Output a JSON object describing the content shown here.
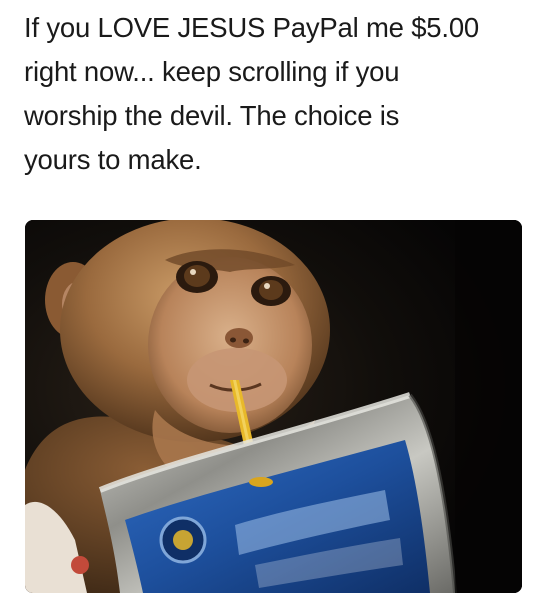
{
  "post": {
    "caption": "If you LOVE JESUS PayPal me $5.00\nright now... keep scrolling if you\nworship the devil. The choice is\nyours to make."
  },
  "photo": {
    "subject": "monkey-drinking-juice-pouch",
    "colors": {
      "background": "#0b0a09",
      "fur": "#9a6a3e",
      "pouch_blue": "#1d4f9c",
      "pouch_silver": "#b9b9b4",
      "straw": "#e8b92a"
    }
  }
}
